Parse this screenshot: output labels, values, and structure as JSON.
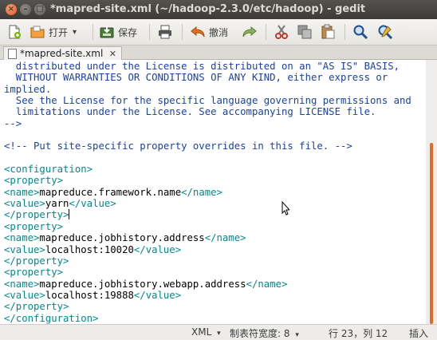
{
  "window": {
    "title": "*mapred-site.xml (~/hadoop-2.3.0/etc/hadoop) - gedit",
    "close_glyph": "×",
    "minimize_glyph": "–",
    "maximize_glyph": "□"
  },
  "toolbar": {
    "open_label": "打开",
    "open_arrow": "▾",
    "save_label": "保存",
    "undo_label": "撤消"
  },
  "tab": {
    "label": "*mapred-site.xml",
    "close_glyph": "✕"
  },
  "editor": {
    "lines": [
      {
        "type": "comment",
        "text": "  distributed under the License is distributed on an \"AS IS\" BASIS,"
      },
      {
        "type": "comment",
        "text": "  WITHOUT WARRANTIES OR CONDITIONS OF ANY KIND, either express or"
      },
      {
        "type": "comment",
        "text": "implied."
      },
      {
        "type": "comment",
        "text": "  See the License for the specific language governing permissions and"
      },
      {
        "type": "comment",
        "text": "  limitations under the License. See accompanying LICENSE file."
      },
      {
        "type": "comment",
        "text": "-->"
      },
      {
        "type": "blank",
        "text": ""
      },
      {
        "type": "comment",
        "text": "<!-- Put site-specific property overrides in this file. -->"
      },
      {
        "type": "blank",
        "text": ""
      },
      {
        "type": "tag",
        "text": "<configuration>"
      },
      {
        "type": "tag",
        "text": "<property>"
      },
      {
        "type": "element",
        "open": "<name>",
        "value": "mapreduce.framework.name",
        "close": "</name>"
      },
      {
        "type": "element",
        "open": "<value>",
        "value": "yarn",
        "close": "</value>"
      },
      {
        "type": "tag",
        "text": "</property>",
        "caret": true
      },
      {
        "type": "tag",
        "text": "<property>"
      },
      {
        "type": "element",
        "open": "<name>",
        "value": "mapreduce.jobhistory.address",
        "close": "</name>"
      },
      {
        "type": "element",
        "open": "<value>",
        "value": "localhost:10020",
        "close": "</value>"
      },
      {
        "type": "tag",
        "text": "</property>"
      },
      {
        "type": "tag",
        "text": "<property>"
      },
      {
        "type": "element",
        "open": "<name>",
        "value": "mapreduce.jobhistory.webapp.address",
        "close": "</name>"
      },
      {
        "type": "element",
        "open": "<value>",
        "value": "localhost:19888",
        "close": "</value>"
      },
      {
        "type": "tag",
        "text": "</property>"
      },
      {
        "type": "tag",
        "text": "</configuration>"
      }
    ]
  },
  "statusbar": {
    "language": "XML",
    "language_arrow": "▾",
    "tab_width": "制表符宽度: 8",
    "tab_width_arrow": "▾",
    "position": "行 23，列 12",
    "mode": "插入"
  },
  "colors": {
    "comment": "#1a3fb0",
    "tag": "#008a8c",
    "scroll_thumb": "#e36a1f"
  }
}
